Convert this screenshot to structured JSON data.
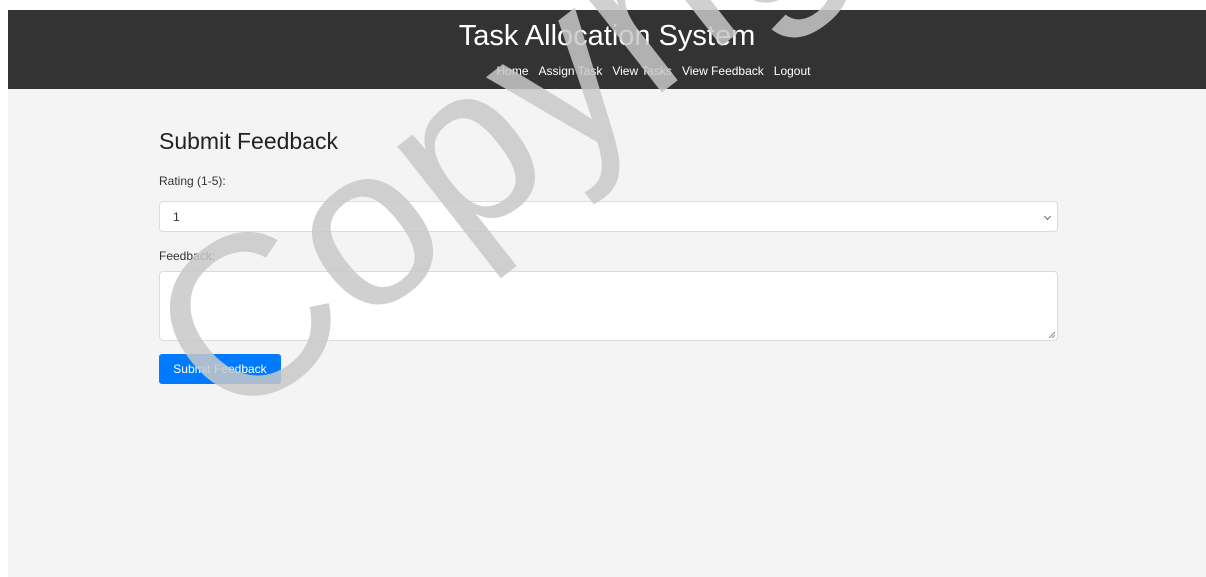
{
  "header": {
    "title": "Task Allocation System",
    "nav": [
      "Home",
      "Assign Task",
      "View Tasks",
      "View Feedback",
      "Logout"
    ]
  },
  "form": {
    "title": "Submit Feedback",
    "rating_label": "Rating (1-5):",
    "rating_value": "1",
    "feedback_label": "Feedback:",
    "feedback_value": "",
    "submit_label": "Submit Feedback"
  },
  "watermark": {
    "text": "Copyright UKM"
  },
  "colors": {
    "header_bg": "#333333",
    "page_bg": "#f4f4f4",
    "button_bg": "#007bff",
    "watermark": "#c8c8c8"
  }
}
